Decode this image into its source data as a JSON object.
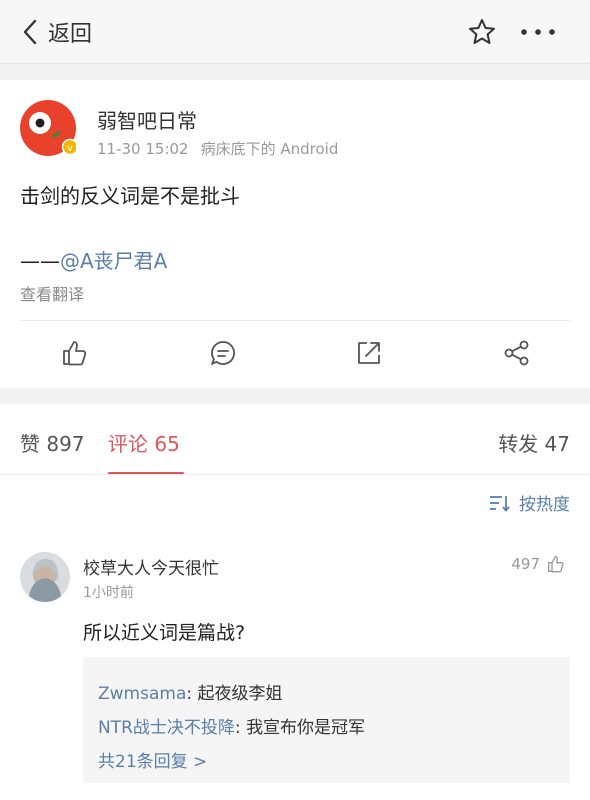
{
  "header": {
    "back_label": "返回",
    "icons": [
      "chevron-left-icon",
      "star-icon",
      "more-icon"
    ]
  },
  "post": {
    "author": "弱智吧日常",
    "time": "11-30 15:02",
    "source": "病床底下的 Android",
    "text": "击剑的反义词是不是批斗",
    "attribution_prefix": "——",
    "mention": "@A丧尸君A",
    "translate_label": "查看翻译",
    "actions": [
      "like-icon",
      "comment-icon",
      "repost-icon",
      "share-icon"
    ],
    "avatar_colors": {
      "bg": "#e8412c",
      "badge": "#f5b400"
    }
  },
  "tabs": {
    "likes": "赞 897",
    "comments": "评论 65",
    "reposts": "转发 47",
    "active_color": "#e0565b"
  },
  "sort_label": "按热度",
  "comment": {
    "user": "校草大人今天很忙",
    "time": "1小时前",
    "likes": "497",
    "text": "所以近义词是篇战?",
    "replies": [
      {
        "user": "Zwmsama",
        "sep": ": ",
        "text": "起夜级李姐"
      },
      {
        "user": "NTR战士决不投降",
        "sep": ": ",
        "text": "我宣布你是冠军"
      }
    ],
    "more_replies": "共21条回复 >"
  },
  "colors": {
    "link": "#5a7fa8",
    "muted": "#999999"
  }
}
